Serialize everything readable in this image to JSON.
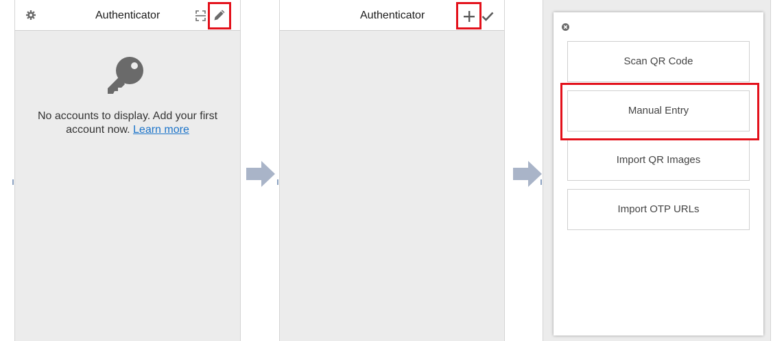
{
  "screen1": {
    "title": "Authenticator",
    "empty_message_line1": "No accounts to display. Add your first",
    "empty_message_line2": "account now.",
    "learn_more": "Learn more",
    "icons": [
      "gear-icon",
      "scan-icon",
      "pencil-icon",
      "key-icon"
    ]
  },
  "screen2": {
    "title": "Authenticator",
    "icons": [
      "plus-icon",
      "check-icon"
    ]
  },
  "screen3": {
    "options": [
      "Scan QR Code",
      "Manual Entry",
      "Import QR Images",
      "Import OTP URLs"
    ],
    "icons": [
      "close-icon"
    ]
  },
  "colors": {
    "highlight": "#e3101a",
    "arrow": "#a9b4c8",
    "link": "#1b73c9",
    "panel_bg": "#ececec"
  }
}
